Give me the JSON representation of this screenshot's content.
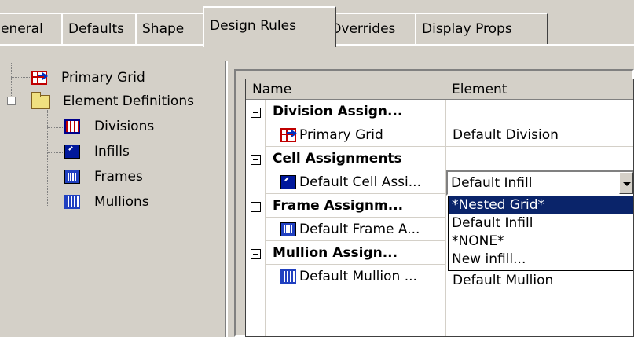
{
  "tabs": [
    {
      "label": "eneral"
    },
    {
      "label": "Defaults"
    },
    {
      "label": "Shape"
    },
    {
      "label": "Design Rules"
    },
    {
      "label": "Overrides"
    },
    {
      "label": "Display Props"
    }
  ],
  "active_tab": "Design Rules",
  "tree": {
    "primary_grid": "Primary Grid",
    "element_definitions": "Element Definitions",
    "children": [
      {
        "label": "Divisions",
        "icon": "divisions-icon"
      },
      {
        "label": "Infills",
        "icon": "infill-icon"
      },
      {
        "label": "Frames",
        "icon": "frame-icon"
      },
      {
        "label": "Mullions",
        "icon": "mullion-icon"
      }
    ]
  },
  "grid": {
    "col_name": "Name",
    "col_element": "Element",
    "rows": [
      {
        "name": "Division Assign...",
        "element": ""
      },
      {
        "name": "Primary Grid",
        "element": "Default Division"
      },
      {
        "name": "Cell Assignments",
        "element": ""
      },
      {
        "name": "Default Cell Assi...",
        "element": "Default Infill"
      },
      {
        "name": "Frame Assignm...",
        "element": ""
      },
      {
        "name": "Default Frame A...",
        "element": ""
      },
      {
        "name": "Mullion Assign...",
        "element": ""
      },
      {
        "name": "Default Mullion ...",
        "element": "Default Mullion"
      }
    ]
  },
  "dropdown": {
    "value": "Default Infill",
    "options": [
      "*Nested Grid*",
      "Default Infill",
      "*NONE*",
      "New infill..."
    ],
    "highlighted": "*Nested Grid*"
  }
}
